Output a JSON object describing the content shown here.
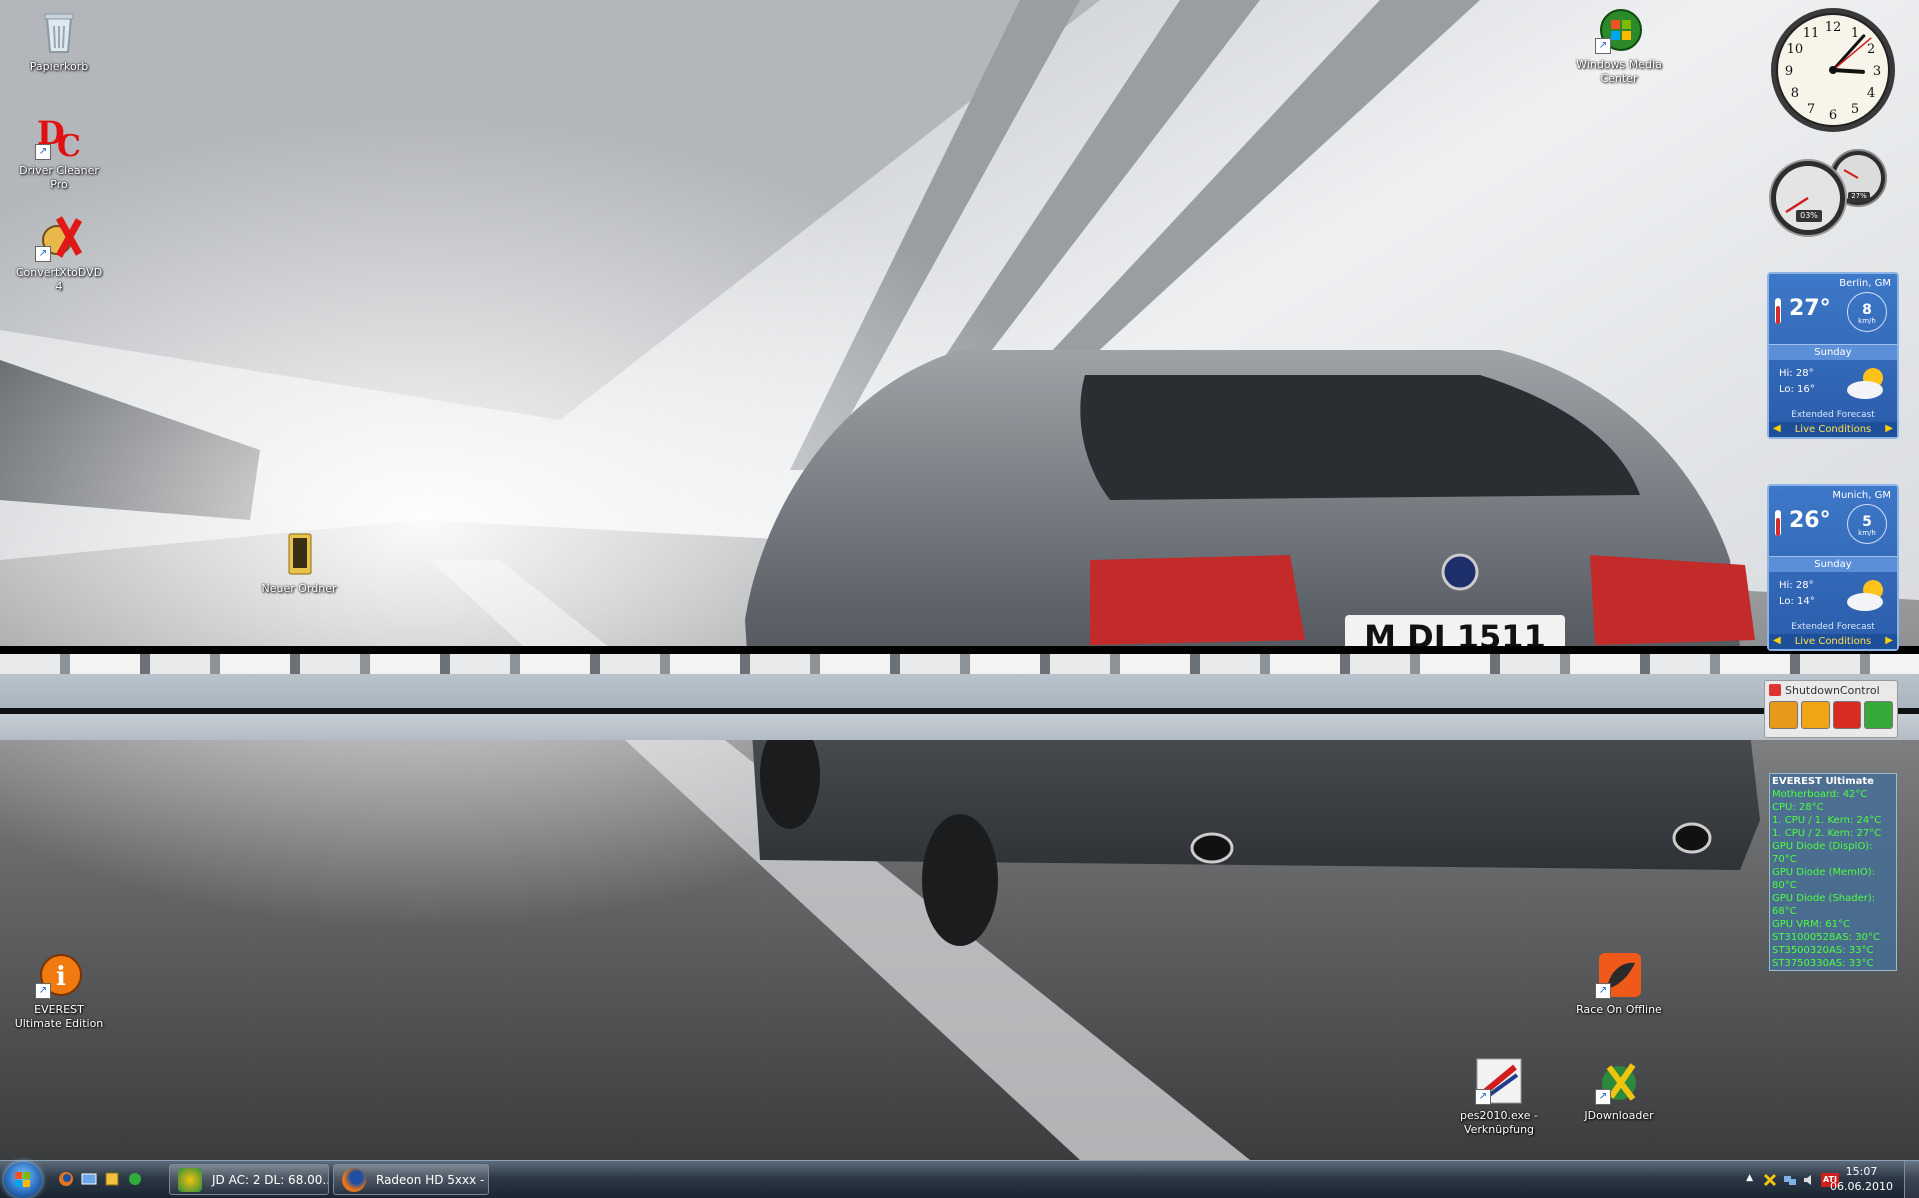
{
  "desktop": {
    "icons": [
      {
        "label": "Papierkorb"
      },
      {
        "label": "Driver Cleaner Pro"
      },
      {
        "label": "ConvertXtoDVD 4"
      },
      {
        "label": "Neuer Ordner"
      },
      {
        "label": "EVEREST Ultimate Edition"
      },
      {
        "label": "Windows Media Center"
      },
      {
        "label": "Race On Offline"
      },
      {
        "label": "pes2010.exe - Verknüpfung"
      },
      {
        "label": "JDownloader"
      }
    ]
  },
  "wallpaper": {
    "license_plate": "M DJ 1511"
  },
  "gadgets": {
    "clock": {
      "hour": 3,
      "minute": 7
    },
    "meters": {
      "cpu_label": "03%",
      "ram_label": "27%"
    },
    "weather": [
      {
        "city": "Berlin, GM",
        "temp": "27°",
        "wind": "8",
        "wind_unit": "km/h",
        "day": "Sunday",
        "hi": "Hi:  28°",
        "lo": "Lo:  16°",
        "extended": "Extended Forecast",
        "live": "Live Conditions"
      },
      {
        "city": "Munich, GM",
        "temp": "26°",
        "wind": "5",
        "wind_unit": "km/h",
        "day": "Sunday",
        "hi": "Hi:  28°",
        "lo": "Lo:  14°",
        "extended": "Extended Forecast",
        "live": "Live Conditions"
      }
    ],
    "shutdown": {
      "title": "ShutdownControl"
    },
    "everest": {
      "title": "EVEREST Ultimate",
      "lines": [
        "Motherboard: 42°C",
        "CPU: 28°C",
        "1. CPU / 1. Kern: 24°C",
        "1. CPU / 2. Kern: 27°C",
        "GPU Diode (DispIO): 70°C",
        "GPU Diode (MemIO): 80°C",
        "GPU Diode (Shader): 68°C",
        "GPU VRM: 61°C",
        "ST31000528AS: 30°C",
        "ST3500320AS: 33°C",
        "ST3750330AS: 33°C"
      ]
    }
  },
  "taskbar": {
    "buttons": [
      {
        "label": "JD AC: 2 DL: 68.00..."
      },
      {
        "label": "Radeon HD 5xxx - ..."
      }
    ],
    "tray": {
      "time": "15:07",
      "date": "06.06.2010",
      "ati": "ATI"
    }
  },
  "colors": {
    "accent": "#2a5caa",
    "everest_text": "#4cff3c",
    "live_text": "#ffe14a"
  }
}
